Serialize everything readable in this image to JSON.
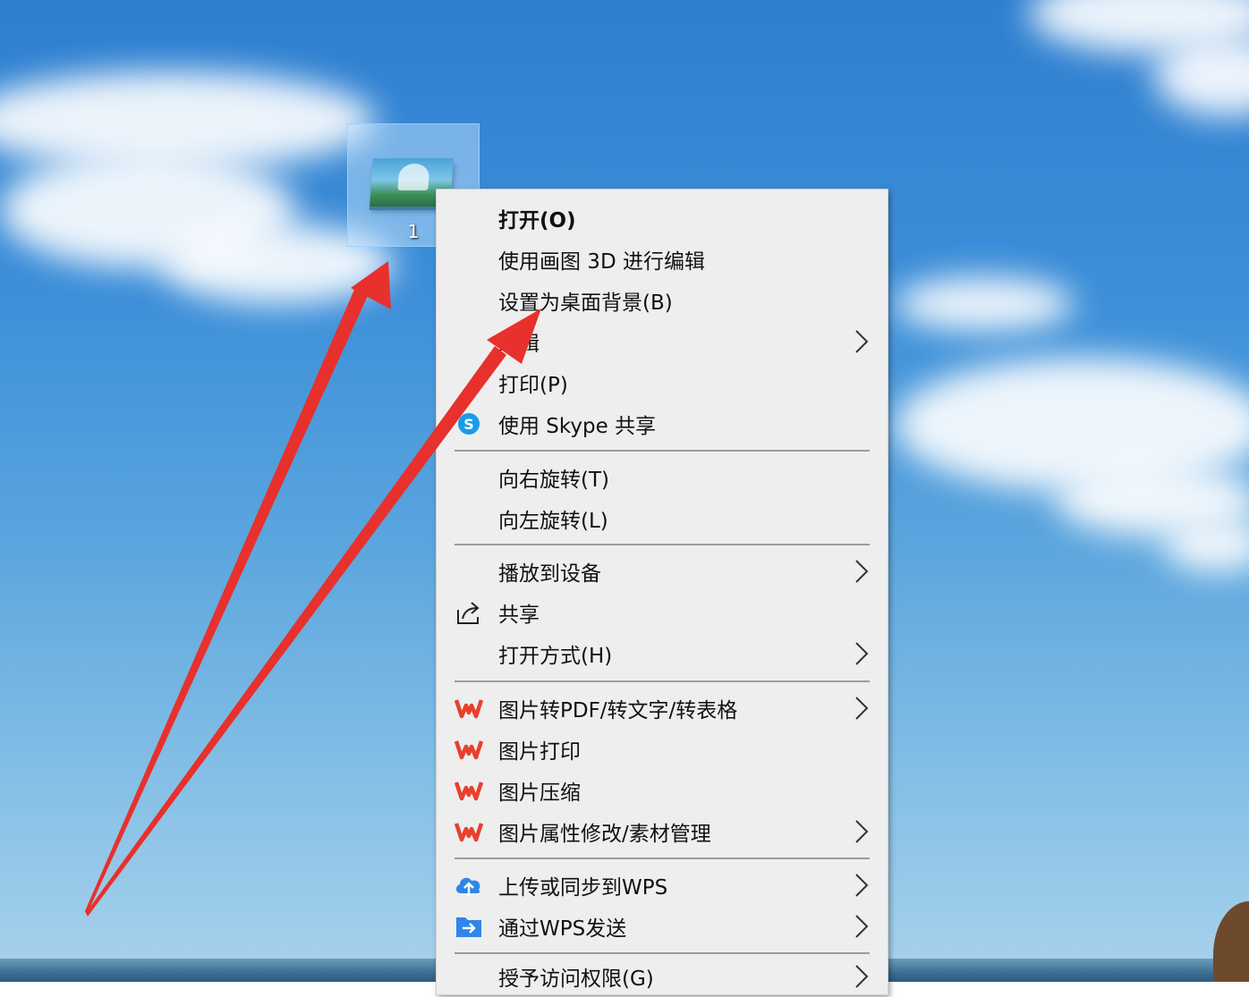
{
  "desktop": {
    "icon_label": "1"
  },
  "context_menu": {
    "items": [
      {
        "label": "打开(O)",
        "icon": "none",
        "submenu": false
      },
      {
        "label": "使用画图 3D 进行编辑",
        "icon": "none",
        "submenu": false
      },
      {
        "label": "设置为桌面背景(B)",
        "icon": "none",
        "submenu": false
      },
      {
        "label": "编辑",
        "icon": "none",
        "submenu": true
      },
      {
        "label": "打印(P)",
        "icon": "none",
        "submenu": false
      },
      {
        "label": "使用 Skype 共享",
        "icon": "skype-icon",
        "submenu": false
      },
      {
        "label": "向右旋转(T)",
        "icon": "none",
        "submenu": false
      },
      {
        "label": "向左旋转(L)",
        "icon": "none",
        "submenu": false
      },
      {
        "label": "播放到设备",
        "icon": "none",
        "submenu": true
      },
      {
        "label": "共享",
        "icon": "share-icon",
        "submenu": false
      },
      {
        "label": "打开方式(H)",
        "icon": "none",
        "submenu": true
      },
      {
        "label": "图片转PDF/转文字/转表格",
        "icon": "wps-icon",
        "submenu": true
      },
      {
        "label": "图片打印",
        "icon": "wps-icon",
        "submenu": false
      },
      {
        "label": "图片压缩",
        "icon": "wps-icon",
        "submenu": false
      },
      {
        "label": "图片属性修改/素材管理",
        "icon": "wps-icon",
        "submenu": true
      },
      {
        "label": "上传或同步到WPS",
        "icon": "wps-cloud-upload-icon",
        "submenu": true
      },
      {
        "label": "通过WPS发送",
        "icon": "wps-send-icon",
        "submenu": true
      },
      {
        "label": "授予访问权限(G)",
        "icon": "none",
        "submenu": true
      }
    ]
  },
  "colors": {
    "menu_background": "#eeeeee",
    "separator": "#9c9c9c",
    "wps_red": "#e8402c",
    "wps_blue": "#2f86e8",
    "annotation_arrow": "#e8302c"
  }
}
